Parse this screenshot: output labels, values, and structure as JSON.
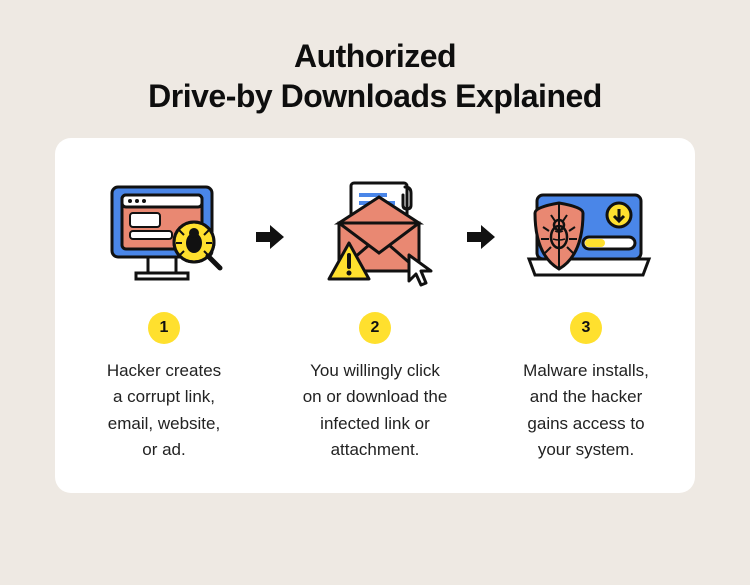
{
  "title_line1": "Authorized",
  "title_line2": "Drive-by Downloads Explained",
  "steps": [
    {
      "number": "1",
      "caption": "Hacker creates\na corrupt link,\nemail, website,\nor ad."
    },
    {
      "number": "2",
      "caption": "You willingly click\non or download the\ninfected link or\nattachment."
    },
    {
      "number": "3",
      "caption": "Malware installs,\nand the hacker\ngains access to\nyour system."
    }
  ],
  "colors": {
    "accent_yellow": "#ffe02e",
    "accent_coral": "#e98872",
    "accent_blue": "#4a86e8",
    "bg_page": "#eee9e3"
  }
}
